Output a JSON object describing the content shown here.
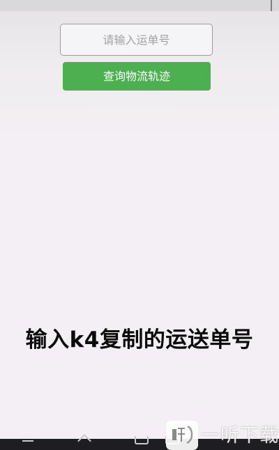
{
  "tracking_form": {
    "input_placeholder": "请输入运单号",
    "input_value": "",
    "query_button_label": "查询物流轨迹",
    "button_color": "#4caf50"
  },
  "overlay": {
    "caption": "输入k4复制的运送单号"
  },
  "watermark": {
    "logo_icon": "yiting-logo-icon",
    "text": "一听下载"
  },
  "navigation_bar": {
    "buttons": [
      "menu-icon",
      "home-icon",
      "recent-apps-icon",
      "back-icon"
    ]
  }
}
